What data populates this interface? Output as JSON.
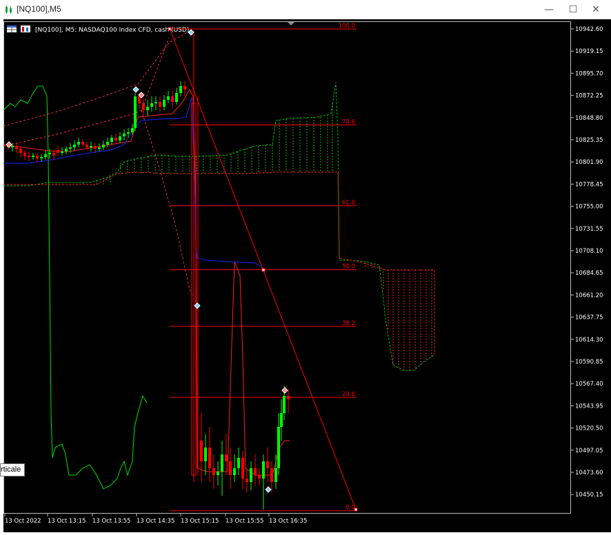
{
  "window": {
    "title": "[NQ100],M5",
    "minimize": "—",
    "maximize": "☐",
    "close": "✕"
  },
  "chart": {
    "header": "[NQ100], M5:  NASDAQ100 Index CFD, cash (USD)",
    "tooltip": "rticale",
    "colors": {
      "background": "#000000",
      "bull": "#00ff00",
      "bear": "#ff0000",
      "frame": "#c0c0c0",
      "text": "#ffffff",
      "fib": "#ff0000"
    },
    "price_axis": [
      "10942.60",
      "10919.15",
      "10895.70",
      "10872.25",
      "10848.80",
      "10825.35",
      "10801.90",
      "10778.45",
      "10755.00",
      "10731.55",
      "10708.10",
      "10684.65",
      "10661.20",
      "10637.75",
      "10614.30",
      "10590.85",
      "10567.40",
      "10543.95",
      "10520.50",
      "10497.05",
      "10473.60",
      "10450.15"
    ],
    "time_axis": [
      "13 Oct 2022",
      "13 Oct 13:15",
      "13 Oct 13:55",
      "13 Oct 14:35",
      "13 Oct 15:15",
      "13 Oct 15:55",
      "13 Oct 16:35"
    ],
    "fibonacci": [
      {
        "label": "100.0",
        "price": 10942.6
      },
      {
        "label": "78.6",
        "price": 10841.1
      },
      {
        "label": "61.8",
        "price": 10755.6
      },
      {
        "label": "50.0",
        "price": 10688.0
      },
      {
        "label": "38.2",
        "price": 10628.0
      },
      {
        "label": "23.6",
        "price": 10553.0
      },
      {
        "label": "0.0",
        "price": 10433.0
      }
    ]
  }
}
